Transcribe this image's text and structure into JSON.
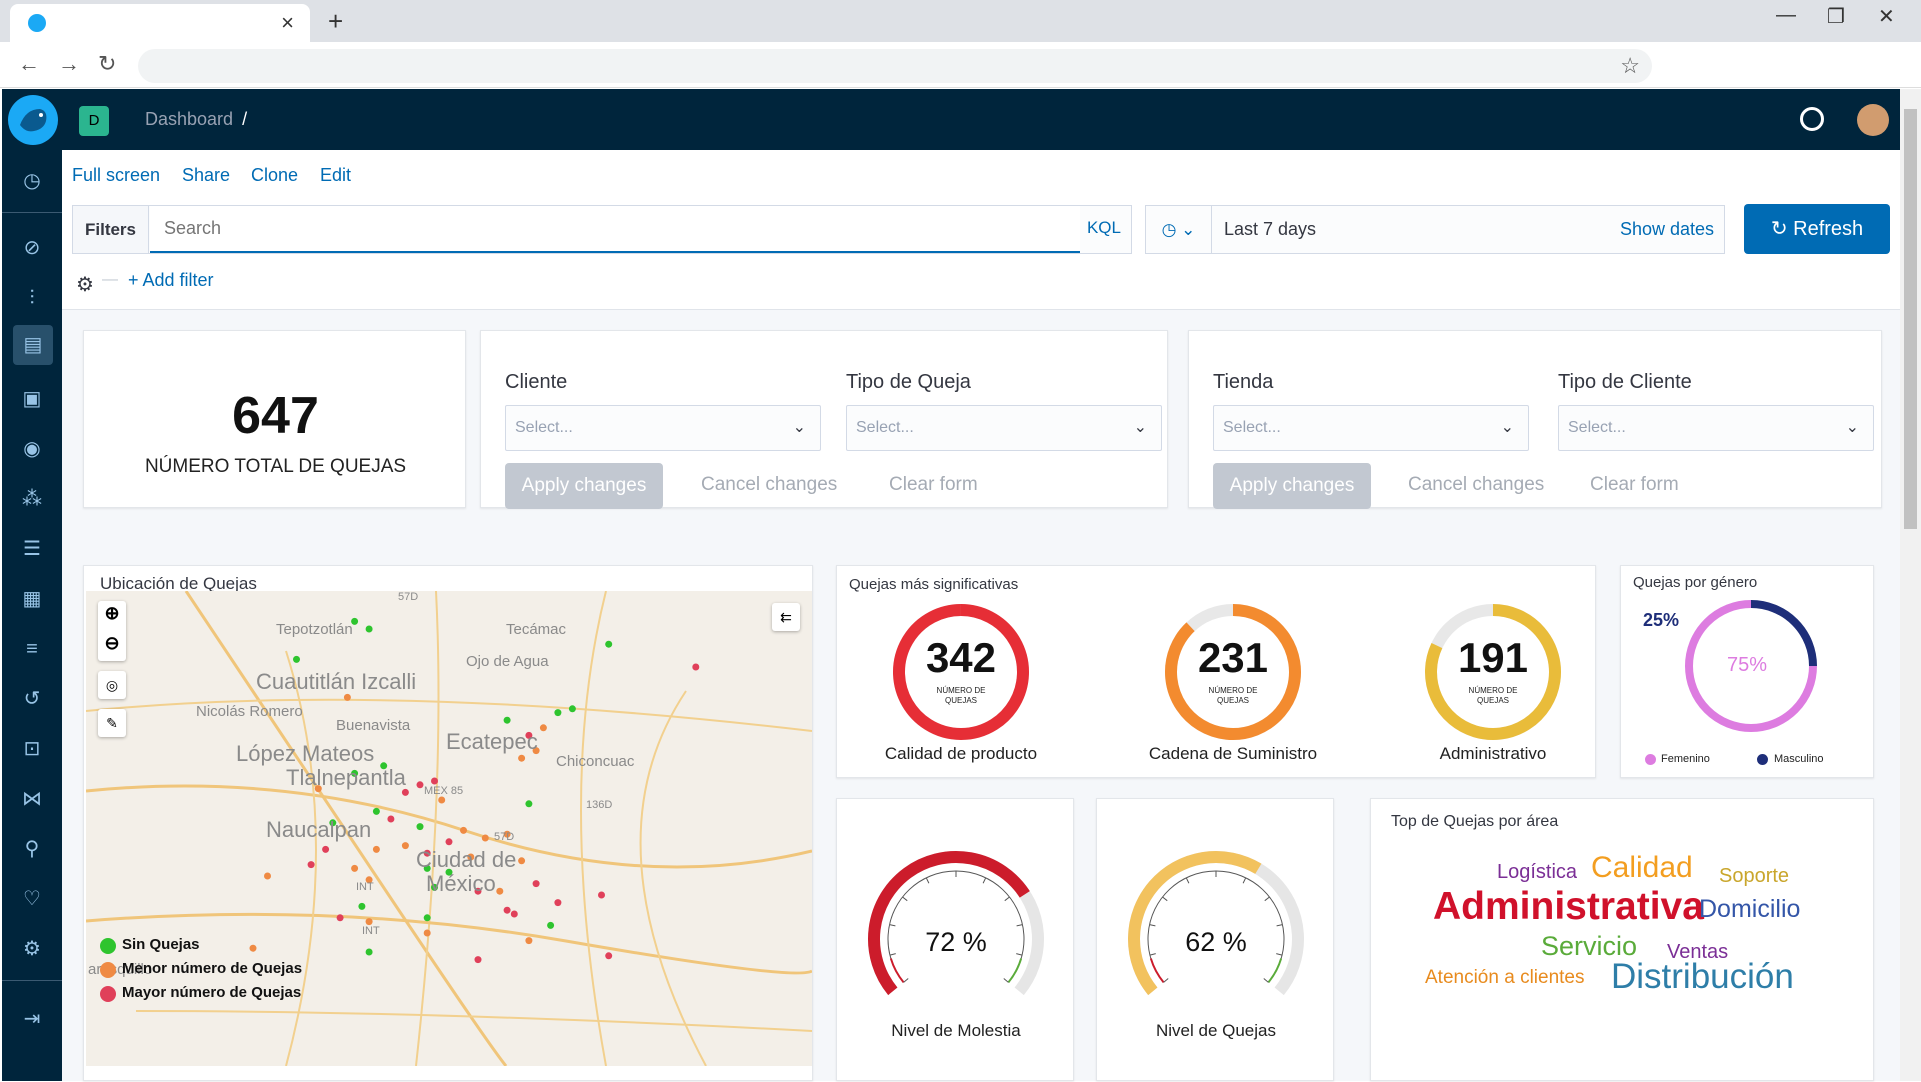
{
  "browser": {
    "new_tab": "+",
    "tab_close": "×",
    "minimize": "—",
    "restore": "❐",
    "close": "✕",
    "back": "←",
    "forward": "→",
    "reload": "↻",
    "bookmark": "☆"
  },
  "header": {
    "space_initial": "D",
    "breadcrumb": "Dashboard",
    "breadcrumb_sep": "/"
  },
  "toolbar": {
    "full_screen": "Full screen",
    "share": "Share",
    "clone": "Clone",
    "edit": "Edit"
  },
  "query_bar": {
    "filters_label": "Filters",
    "search_placeholder": "Search",
    "kql": "KQL",
    "time_range": "Last 7 days",
    "show_dates": "Show dates",
    "refresh": "Refresh",
    "add_filter": "+ Add filter"
  },
  "metric": {
    "value": "647",
    "label": "NÚMERO TOTAL DE QUEJAS"
  },
  "controls_1": {
    "field_a": "Cliente",
    "field_b": "Tipo de Queja",
    "placeholder": "Select...",
    "apply": "Apply changes",
    "cancel": "Cancel changes",
    "clear": "Clear form"
  },
  "controls_2": {
    "field_a": "Tienda",
    "field_b": "Tipo de Cliente",
    "placeholder": "Select...",
    "apply": "Apply changes",
    "cancel": "Cancel changes",
    "clear": "Clear form"
  },
  "map": {
    "title": "Ubicación de Quejas",
    "places": [
      "Tepotzotlán",
      "Tecámac",
      "Ojo de Agua",
      "Cuautitlán Izcalli",
      "Nicolás Romero",
      "Buenavista",
      "López Mateos",
      "Ecatepec",
      "Chiconcuac",
      "Tlalnepantla",
      "Naucalpan",
      "Ciudad de",
      "México",
      "57D",
      "MEX 85",
      "136D",
      "57D",
      "INT",
      "INT",
      "arasquillo"
    ],
    "legend": [
      {
        "label": "Sin  Quejas",
        "color": "#2ec42e"
      },
      {
        "label": "Menor número de Quejas",
        "color": "#ef8a43"
      },
      {
        "label": "Mayor número de Quejas",
        "color": "#e0405a"
      }
    ],
    "points": [
      {
        "lat": 0.08,
        "lon": 0.37,
        "level": "green"
      },
      {
        "lat": 0.1,
        "lon": 0.39,
        "level": "green"
      },
      {
        "lat": 0.14,
        "lon": 0.72,
        "level": "green"
      },
      {
        "lat": 0.18,
        "lon": 0.29,
        "level": "green"
      },
      {
        "lat": 0.2,
        "lon": 0.84,
        "level": "red"
      },
      {
        "lat": 0.28,
        "lon": 0.36,
        "level": "orange"
      },
      {
        "lat": 0.31,
        "lon": 0.67,
        "level": "green"
      },
      {
        "lat": 0.32,
        "lon": 0.65,
        "level": "green"
      },
      {
        "lat": 0.34,
        "lon": 0.58,
        "level": "green"
      },
      {
        "lat": 0.36,
        "lon": 0.63,
        "level": "orange"
      },
      {
        "lat": 0.38,
        "lon": 0.61,
        "level": "red"
      },
      {
        "lat": 0.42,
        "lon": 0.62,
        "level": "orange"
      },
      {
        "lat": 0.44,
        "lon": 0.6,
        "level": "orange"
      },
      {
        "lat": 0.46,
        "lon": 0.41,
        "level": "green"
      },
      {
        "lat": 0.48,
        "lon": 0.37,
        "level": "green"
      },
      {
        "lat": 0.5,
        "lon": 0.48,
        "level": "red"
      },
      {
        "lat": 0.51,
        "lon": 0.46,
        "level": "red"
      },
      {
        "lat": 0.52,
        "lon": 0.32,
        "level": "orange"
      },
      {
        "lat": 0.53,
        "lon": 0.44,
        "level": "red"
      },
      {
        "lat": 0.55,
        "lon": 0.49,
        "level": "orange"
      },
      {
        "lat": 0.56,
        "lon": 0.61,
        "level": "green"
      },
      {
        "lat": 0.58,
        "lon": 0.4,
        "level": "green"
      },
      {
        "lat": 0.6,
        "lon": 0.42,
        "level": "red"
      },
      {
        "lat": 0.61,
        "lon": 0.34,
        "level": "green"
      },
      {
        "lat": 0.62,
        "lon": 0.46,
        "level": "green"
      },
      {
        "lat": 0.63,
        "lon": 0.52,
        "level": "orange"
      },
      {
        "lat": 0.64,
        "lon": 0.58,
        "level": "orange"
      },
      {
        "lat": 0.65,
        "lon": 0.55,
        "level": "orange"
      },
      {
        "lat": 0.66,
        "lon": 0.5,
        "level": "red"
      },
      {
        "lat": 0.67,
        "lon": 0.44,
        "level": "orange"
      },
      {
        "lat": 0.68,
        "lon": 0.33,
        "level": "red"
      },
      {
        "lat": 0.68,
        "lon": 0.4,
        "level": "orange"
      },
      {
        "lat": 0.69,
        "lon": 0.47,
        "level": "red"
      },
      {
        "lat": 0.7,
        "lon": 0.53,
        "level": "orange"
      },
      {
        "lat": 0.71,
        "lon": 0.6,
        "level": "orange"
      },
      {
        "lat": 0.72,
        "lon": 0.31,
        "level": "red"
      },
      {
        "lat": 0.73,
        "lon": 0.37,
        "level": "orange"
      },
      {
        "lat": 0.73,
        "lon": 0.47,
        "level": "green"
      },
      {
        "lat": 0.74,
        "lon": 0.5,
        "level": "green"
      },
      {
        "lat": 0.75,
        "lon": 0.25,
        "level": "orange"
      },
      {
        "lat": 0.76,
        "lon": 0.39,
        "level": "orange"
      },
      {
        "lat": 0.77,
        "lon": 0.62,
        "level": "red"
      },
      {
        "lat": 0.78,
        "lon": 0.48,
        "level": "green"
      },
      {
        "lat": 0.79,
        "lon": 0.54,
        "level": "red"
      },
      {
        "lat": 0.79,
        "lon": 0.57,
        "level": "orange"
      },
      {
        "lat": 0.8,
        "lon": 0.71,
        "level": "red"
      },
      {
        "lat": 0.82,
        "lon": 0.65,
        "level": "red"
      },
      {
        "lat": 0.83,
        "lon": 0.38,
        "level": "green"
      },
      {
        "lat": 0.84,
        "lon": 0.58,
        "level": "red"
      },
      {
        "lat": 0.85,
        "lon": 0.59,
        "level": "red"
      },
      {
        "lat": 0.86,
        "lon": 0.47,
        "level": "green"
      },
      {
        "lat": 0.86,
        "lon": 0.35,
        "level": "red"
      },
      {
        "lat": 0.87,
        "lon": 0.39,
        "level": "orange"
      },
      {
        "lat": 0.88,
        "lon": 0.64,
        "level": "green"
      },
      {
        "lat": 0.9,
        "lon": 0.47,
        "level": "orange"
      },
      {
        "lat": 0.92,
        "lon": 0.61,
        "level": "orange"
      },
      {
        "lat": 0.94,
        "lon": 0.23,
        "level": "orange"
      },
      {
        "lat": 0.95,
        "lon": 0.39,
        "level": "green"
      },
      {
        "lat": 0.96,
        "lon": 0.72,
        "level": "red"
      },
      {
        "lat": 0.97,
        "lon": 0.54,
        "level": "red"
      }
    ]
  },
  "significant": {
    "title": "Quejas más significativas",
    "sub": "NÚMERO DE QUEJAS",
    "items": [
      {
        "value": "342",
        "label": "Calidad de producto",
        "color": "#e62e36",
        "fraction": 1.0
      },
      {
        "value": "231",
        "label": "Cadena de Suministro",
        "color": "#f38b2f",
        "fraction": 0.88
      },
      {
        "value": "191",
        "label": "Administrativo",
        "color": "#e9bc3a",
        "fraction": 0.82
      }
    ]
  },
  "gender": {
    "title": "Quejas por género",
    "pct_a": "25%",
    "pct_b": "75%",
    "legend_a": "Femenino",
    "legend_b": "Masculino",
    "color_a": "#dd7ce0",
    "color_b": "#1e2e79"
  },
  "gauges": [
    {
      "value": "72 %",
      "label": "Nivel de Molestia",
      "pct": 72,
      "color": "#cc1c2b"
    },
    {
      "value": "62 %",
      "label": "Nivel de Quejas",
      "pct": 62,
      "color": "#f2c25e"
    }
  ],
  "tagcloud": {
    "title": "Top de Quejas por área",
    "tags": [
      {
        "text": "Logística",
        "color": "#7b2f96"
      },
      {
        "text": "Calidad",
        "color": "#f39e20"
      },
      {
        "text": "Soporte",
        "color": "#c9a62c"
      },
      {
        "text": "Administrativa",
        "color": "#d0112b"
      },
      {
        "text": "Domicilio",
        "color": "#3456a8"
      },
      {
        "text": "Servicio",
        "color": "#5aab3a"
      },
      {
        "text": "Ventas",
        "color": "#7b2f96"
      },
      {
        "text": "Atención a clientes",
        "color": "#e88b1e"
      },
      {
        "text": "Distribución",
        "color": "#2e7ea8"
      }
    ]
  }
}
